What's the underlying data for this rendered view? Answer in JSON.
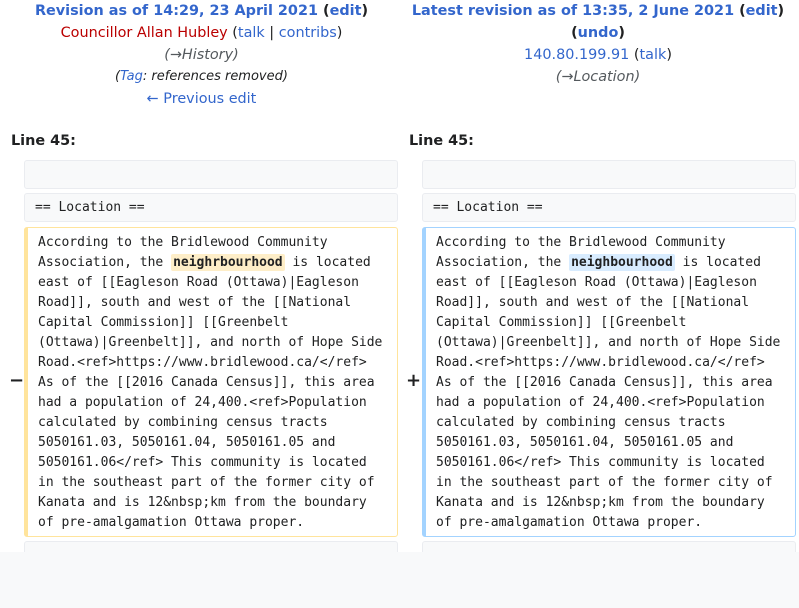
{
  "left": {
    "revision_prefix": "Revision as of 14:29, 23 April 2021",
    "edit": "edit",
    "user": "Councillor Allan Hubley",
    "talk": "talk",
    "contribs": "contribs",
    "summary": "(→History)",
    "tag_link": "Tag",
    "tag_rest": ": references removed)",
    "tag_open": "(",
    "prev_edit": "← Previous edit",
    "line_label": "Line 45:",
    "heading": "== Location ==",
    "para_pre": "According to the Bridlewood Community\nAssociation, the ",
    "changed_word": "neighrbourhood",
    "para_post": " is located\neast of [[Eagleson Road (Ottawa)|Eagleson\nRoad]], south and west of the [[National\nCapital Commission]] [[Greenbelt\n(Ottawa)|Greenbelt]], and north of Hope Side\nRoad.<ref>https://www.bridlewood.ca/</ref>\nAs of the [[2016 Canada Census]], this area\nhad a population of 24,400.<ref>Population\ncalculated by combining census tracts\n5050161.03, 5050161.04, 5050161.05 and\n5050161.06</ref> This community is located\nin the southeast part of the former city of\nKanata and is 12&nbsp;km from the boundary\nof pre-amalgamation Ottawa proper.",
    "marker": "−"
  },
  "right": {
    "revision_prefix": "Latest revision as of 13:35, 2 June 2021",
    "edit": "edit",
    "undo": "undo",
    "user": "140.80.199.91",
    "talk": "talk",
    "summary": "(→Location)",
    "line_label": "Line 45:",
    "heading": "== Location ==",
    "para_pre": "According to the Bridlewood Community\nAssociation, the ",
    "changed_word": "neighbourhood",
    "para_post": " is located\neast of [[Eagleson Road (Ottawa)|Eagleson\nRoad]], south and west of the [[National\nCapital Commission]] [[Greenbelt\n(Ottawa)|Greenbelt]], and north of Hope Side\nRoad.<ref>https://www.bridlewood.ca/</ref>\nAs of the [[2016 Canada Census]], this area\nhad a population of 24,400.<ref>Population\ncalculated by combining census tracts\n5050161.03, 5050161.04, 5050161.05 and\n5050161.06</ref> This community is located\nin the southeast part of the former city of\nKanata and is 12&nbsp;km from the boundary\nof pre-amalgamation Ottawa proper.",
    "marker": "+"
  }
}
